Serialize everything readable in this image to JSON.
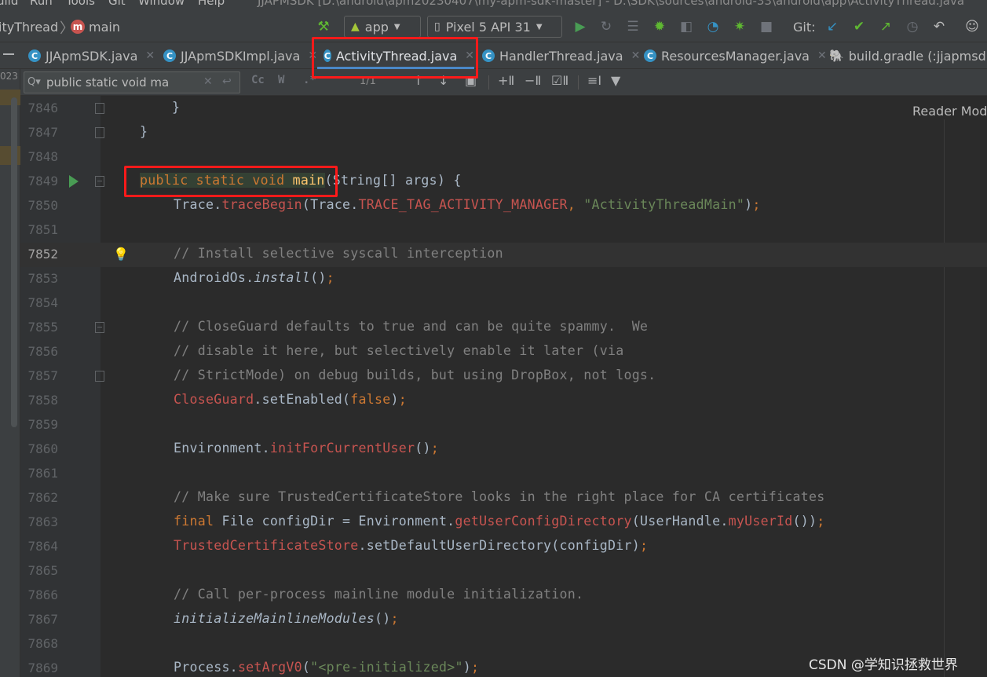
{
  "menubar": {
    "items": [
      "uild",
      "Run",
      "Tools",
      "Git",
      "Window",
      "Help"
    ],
    "title_path": "JJAPMSDK [D:\\android\\apm20230407\\my-apm-sdk-master] - D:\\SDK\\sources\\android-33\\android\\app\\ActivityThread.java"
  },
  "navbar": {
    "breadcrumb_class": "ityThread",
    "breadcrumb_method": "main",
    "method_badge": "m",
    "run_config": "app",
    "device": "Pixel 5 API 31",
    "git_label": "Git:"
  },
  "tabs": [
    {
      "label": "JJApmSDK.java",
      "icon": "java-class-icon",
      "active": false
    },
    {
      "label": "JJApmSDKImpl.java",
      "icon": "java-class-icon",
      "active": false
    },
    {
      "label": "ActivityThread.java",
      "icon": "java-class-icon",
      "active": true
    },
    {
      "label": "HandlerThread.java",
      "icon": "java-class-icon",
      "active": false
    },
    {
      "label": "ResourcesManager.java",
      "icon": "java-class-icon",
      "active": false
    },
    {
      "label": "build.gradle (:jjapmsdk)",
      "icon": "gradle-icon",
      "active": false
    }
  ],
  "search": {
    "query": "public static void ma",
    "match_count": "1/1",
    "case_option": "Cc",
    "word_option": "W"
  },
  "left_strip": {
    "number": "023"
  },
  "editor": {
    "reader_mode": "Reader Mode",
    "current_line": "7852",
    "lines": [
      {
        "n": "7846",
        "text": "    }"
      },
      {
        "n": "7847",
        "text": "}"
      },
      {
        "n": "7848",
        "text": ""
      },
      {
        "n": "7849",
        "text": "public static void main(String[] args) {"
      },
      {
        "n": "7850",
        "text": "Trace.traceBegin(Trace.TRACE_TAG_ACTIVITY_MANAGER, \"ActivityThreadMain\");"
      },
      {
        "n": "7851",
        "text": ""
      },
      {
        "n": "7852",
        "text": "// Install selective syscall interception"
      },
      {
        "n": "7853",
        "text": "AndroidOs.install();"
      },
      {
        "n": "7854",
        "text": ""
      },
      {
        "n": "7855",
        "text": "// CloseGuard defaults to true and can be quite spammy.  We"
      },
      {
        "n": "7856",
        "text": "// disable it here, but selectively enable it later (via"
      },
      {
        "n": "7857",
        "text": "// StrictMode) on debug builds, but using DropBox, not logs."
      },
      {
        "n": "7858",
        "text": "CloseGuard.setEnabled(false);"
      },
      {
        "n": "7859",
        "text": ""
      },
      {
        "n": "7860",
        "text": "Environment.initForCurrentUser();"
      },
      {
        "n": "7861",
        "text": ""
      },
      {
        "n": "7862",
        "text": "// Make sure TrustedCertificateStore looks in the right place for CA certificates"
      },
      {
        "n": "7863",
        "text": "final File configDir = Environment.getUserConfigDirectory(UserHandle.myUserId());"
      },
      {
        "n": "7864",
        "text": "TrustedCertificateStore.setDefaultUserDirectory(configDir);"
      },
      {
        "n": "7865",
        "text": ""
      },
      {
        "n": "7866",
        "text": "// Call per-process mainline module initialization."
      },
      {
        "n": "7867",
        "text": "initializeMainlineModules();"
      },
      {
        "n": "7868",
        "text": ""
      },
      {
        "n": "7869",
        "text": "Process.setArgV0(\"<pre-initialized>\");"
      }
    ]
  },
  "watermark": "CSDN @学知识拯救世界",
  "colors": {
    "editor_bg": "#2b2b2b",
    "chrome_bg": "#3c3f41",
    "keyword": "#cc7832",
    "string": "#6a8759",
    "comment": "#808080",
    "method_call": "#c75450",
    "annotation_red": "#ff1a1a",
    "active_tab_underline": "#4a88c7"
  }
}
